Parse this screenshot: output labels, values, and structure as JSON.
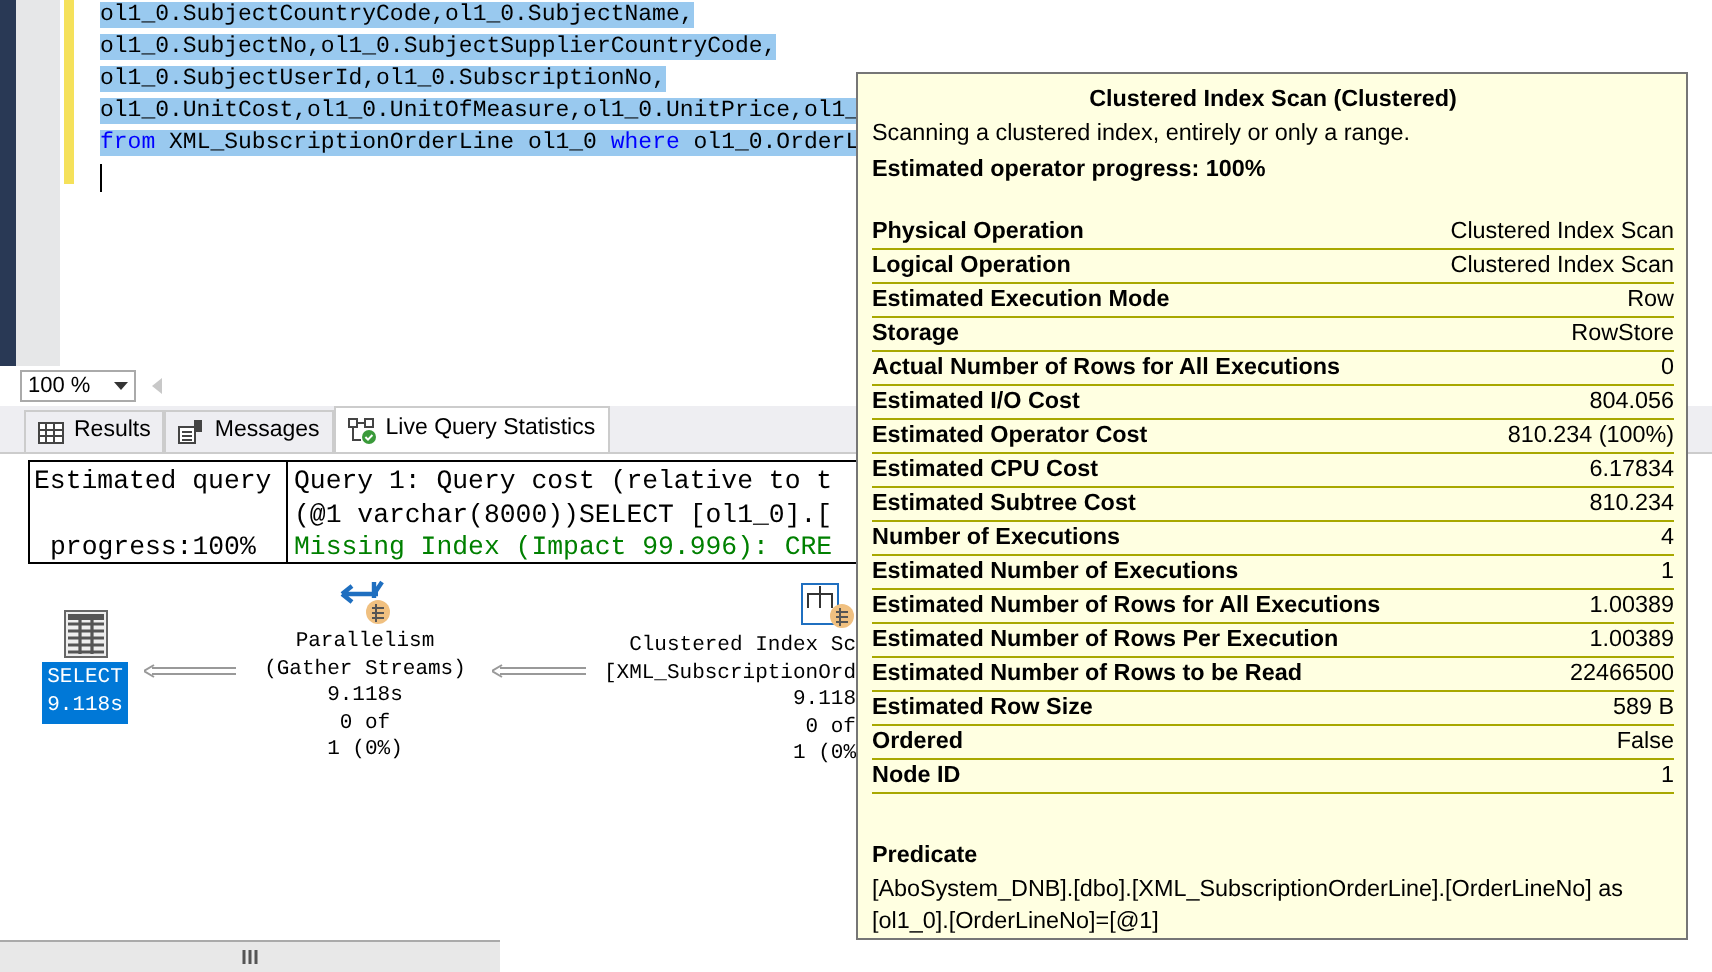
{
  "editor": {
    "lines": [
      {
        "selected": true,
        "tokens": [
          {
            "text": "ol1_0.SubjectCountryCode,ol1_0.SubjectName,",
            "kind": "plain"
          }
        ]
      },
      {
        "selected": true,
        "tokens": [
          {
            "text": "ol1_0.SubjectNo,ol1_0.SubjectSupplierCountryCode,",
            "kind": "plain"
          }
        ]
      },
      {
        "selected": true,
        "tokens": [
          {
            "text": "ol1_0.SubjectUserId,ol1_0.SubscriptionNo,",
            "kind": "plain"
          }
        ]
      },
      {
        "selected": true,
        "tokens": [
          {
            "text": "ol1_0.UnitCost,ol1_0.UnitOfMeasure,ol1_0.UnitPrice,ol1_",
            "kind": "plain"
          }
        ]
      },
      {
        "selected": true,
        "tokens": [
          {
            "text": "from",
            "kind": "keyword"
          },
          {
            "text": " XML_SubscriptionOrderLine ol1_0 ",
            "kind": "plain"
          },
          {
            "text": "where",
            "kind": "keyword"
          },
          {
            "text": " ol1_0.OrderL",
            "kind": "plain"
          }
        ]
      }
    ]
  },
  "zoom": {
    "value": "100 %"
  },
  "tabs": [
    {
      "label": "Results",
      "selected": false
    },
    {
      "label": "Messages",
      "selected": false
    },
    {
      "label": "Live Query Statistics",
      "selected": true
    }
  ],
  "progress": {
    "line_1": "Estimated query",
    "line_2": "progress:100%"
  },
  "messages": [
    {
      "text": "Query 1: Query cost (relative to t",
      "kind": "plain"
    },
    {
      "text": "(@1 varchar(8000))SELECT [ol1_0].[",
      "kind": "plain"
    },
    {
      "text": "Missing Index (Impact 99.996): CRE",
      "kind": "hint"
    }
  ],
  "plan": {
    "nodes": [
      {
        "kind": "select",
        "selected": true,
        "lines": [
          "SELECT",
          "9.118s"
        ]
      },
      {
        "kind": "parallelism",
        "selected": false,
        "lines": [
          "Parallelism",
          "(Gather Streams)",
          "9.118s",
          "0 of",
          "1 (0%)"
        ]
      },
      {
        "kind": "scan",
        "selected": false,
        "lines": [
          "Clustered Index Sc",
          "[XML_SubscriptionOrd",
          "9.118",
          "0 of",
          "1 (0%"
        ]
      }
    ]
  },
  "tooltip": {
    "title": "Clustered Index Scan (Clustered)",
    "description": "Scanning a clustered index, entirely or only a range.",
    "progress": "Estimated operator progress: 100%",
    "properties": [
      {
        "label": "Physical Operation",
        "value": "Clustered Index Scan"
      },
      {
        "label": "Logical Operation",
        "value": "Clustered Index Scan"
      },
      {
        "label": "Estimated Execution Mode",
        "value": "Row"
      },
      {
        "label": "Storage",
        "value": "RowStore"
      },
      {
        "label": "Actual Number of Rows for All Executions",
        "value": "0"
      },
      {
        "label": "Estimated I/O Cost",
        "value": "804.056"
      },
      {
        "label": "Estimated Operator Cost",
        "value": "810.234 (100%)"
      },
      {
        "label": "Estimated CPU Cost",
        "value": "6.17834"
      },
      {
        "label": "Estimated Subtree Cost",
        "value": "810.234"
      },
      {
        "label": "Number of Executions",
        "value": "4"
      },
      {
        "label": "Estimated Number of Executions",
        "value": "1"
      },
      {
        "label": "Estimated Number of Rows for All Executions",
        "value": "1.00389"
      },
      {
        "label": "Estimated Number of Rows Per Execution",
        "value": "1.00389"
      },
      {
        "label": "Estimated Number of Rows to be Read",
        "value": "22466500"
      },
      {
        "label": "Estimated Row Size",
        "value": "589 B"
      },
      {
        "label": "Ordered",
        "value": "False"
      },
      {
        "label": "Node ID",
        "value": "1"
      }
    ],
    "predicate": {
      "label": "Predicate",
      "text": "[AboSystem_DNB].[dbo].[XML_SubscriptionOrderLine].[OrderLineNo] as [ol1_0].[OrderLineNo]=[@1]"
    }
  }
}
